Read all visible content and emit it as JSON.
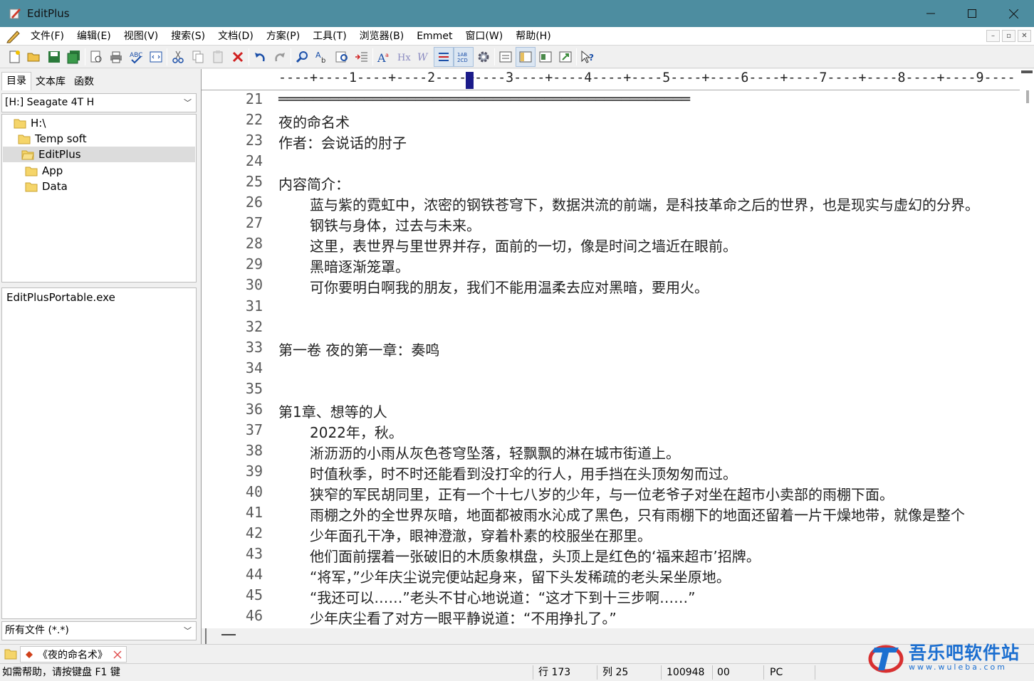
{
  "window": {
    "title": "EditPlus"
  },
  "menu": [
    "文件(F)",
    "编辑(E)",
    "视图(V)",
    "搜索(S)",
    "文档(D)",
    "方案(P)",
    "工具(T)",
    "浏览器(B)",
    "Emmet",
    "窗口(W)",
    "帮助(H)"
  ],
  "panel": {
    "tabs": [
      "目录",
      "文本库",
      "函数"
    ],
    "drive": "[H:] Seagate 4T H",
    "tree": [
      "H:\\",
      "Temp soft",
      "EditPlus",
      "App",
      "Data"
    ],
    "selected_folder": "EditPlus",
    "files": [
      "EditPlusPortable.exe"
    ],
    "filter": "所有文件 (*.*)"
  },
  "ruler": "----+----1----+----2----+----3----+----4----+----5----+----6----+----7----+----8----+----9----",
  "editor": {
    "lines": [
      {
        "n": "21",
        "t": "════════════════════════════════════════════════",
        "indent": false
      },
      {
        "n": "22",
        "t": "夜的命名术",
        "indent": false
      },
      {
        "n": "23",
        "t": "作者：会说话的肘子",
        "indent": false
      },
      {
        "n": "24",
        "t": "",
        "indent": false
      },
      {
        "n": "25",
        "t": "内容简介：",
        "indent": false
      },
      {
        "n": "26",
        "t": "蓝与紫的霓虹中，浓密的钢铁苍穹下，数据洪流的前端，是科技革命之后的世界，也是现实与虚幻的分界。",
        "indent": true
      },
      {
        "n": "27",
        "t": "钢铁与身体，过去与未来。",
        "indent": true
      },
      {
        "n": "28",
        "t": "这里，表世界与里世界并存，面前的一切，像是时间之墙近在眼前。",
        "indent": true
      },
      {
        "n": "29",
        "t": "黑暗逐渐笼罩。",
        "indent": true
      },
      {
        "n": "30",
        "t": "可你要明白啊我的朋友，我们不能用温柔去应对黑暗，要用火。",
        "indent": true
      },
      {
        "n": "31",
        "t": "",
        "indent": false
      },
      {
        "n": "32",
        "t": "",
        "indent": false
      },
      {
        "n": "33",
        "t": "第一卷 夜的第一章：奏鸣",
        "indent": false
      },
      {
        "n": "34",
        "t": "",
        "indent": false
      },
      {
        "n": "35",
        "t": "",
        "indent": false
      },
      {
        "n": "36",
        "t": "第1章、想等的人",
        "indent": false
      },
      {
        "n": "37",
        "t": "2022年，秋。",
        "indent": true
      },
      {
        "n": "38",
        "t": "淅沥沥的小雨从灰色苍穹坠落，轻飘飘的淋在城市街道上。",
        "indent": true
      },
      {
        "n": "39",
        "t": "时值秋季，时不时还能看到没打伞的行人，用手挡在头顶匆匆而过。",
        "indent": true
      },
      {
        "n": "40",
        "t": "狭窄的军民胡同里，正有一个十七八岁的少年，与一位老爷子对坐在超市小卖部的雨棚下面。",
        "indent": true
      },
      {
        "n": "41",
        "t": "雨棚之外的全世界灰暗，地面都被雨水沁成了黑色，只有雨棚下的地面还留着一片干燥地带，就像是整个",
        "indent": true
      },
      {
        "n": "42",
        "t": "少年面孔干净，眼神澄澈，穿着朴素的校服坐在那里。",
        "indent": true
      },
      {
        "n": "43",
        "t": "他们面前摆着一张破旧的木质象棋盘，头顶上是红色的‘福来超市’招牌。",
        "indent": true
      },
      {
        "n": "44",
        "t": "“将军，”少年庆尘说完便站起身来，留下头发稀疏的老头呆坐原地。",
        "indent": true
      },
      {
        "n": "45",
        "t": "“我还可以……”老头不甘心地说道：“这才下到十三步啊……”",
        "indent": true
      },
      {
        "n": "46",
        "t": "少年庆尘看了对方一眼平静说道：“不用挣扎了。”",
        "indent": true
      }
    ]
  },
  "doc_tab": "《夜的命名术》",
  "status": {
    "help": "如需帮助，请按键盘 F1 键",
    "row": "行 173",
    "col": "列 25",
    "size": "100948",
    "code": "00",
    "mode": "PC"
  },
  "watermark": {
    "title": "吾乐吧软件站",
    "url": "www.wuleba.com"
  }
}
